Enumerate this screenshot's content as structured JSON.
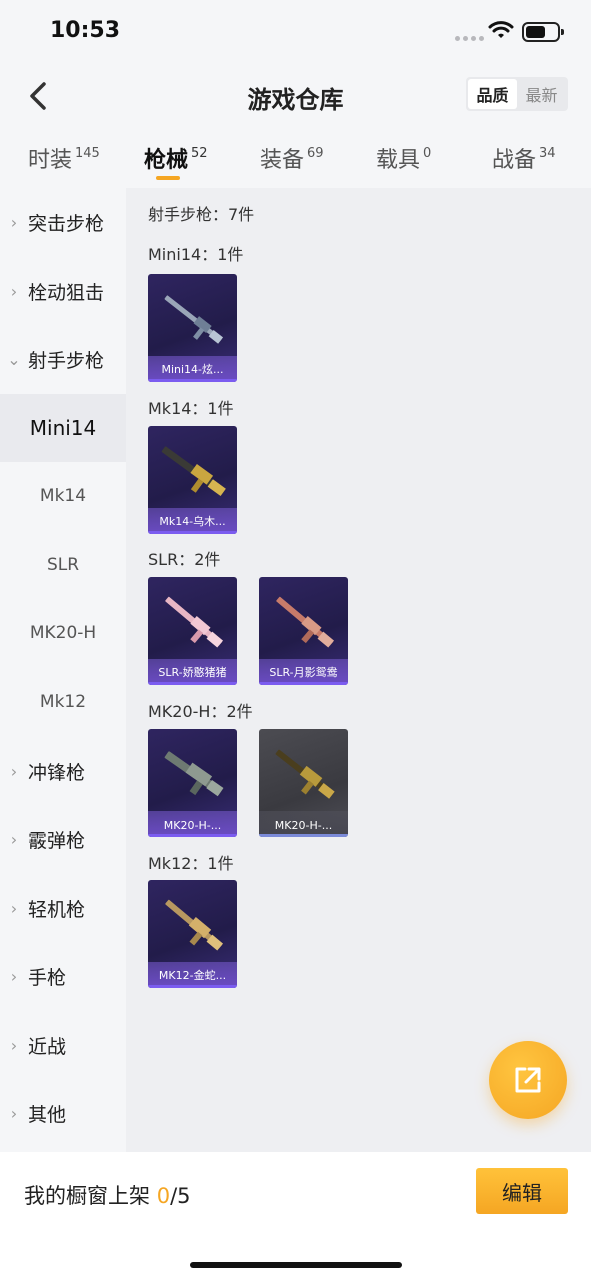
{
  "status": {
    "time": "10:53"
  },
  "nav": {
    "title": "游戏仓库",
    "sort": [
      "品质",
      "最新"
    ]
  },
  "tabs": [
    {
      "label": "时装",
      "count": "145"
    },
    {
      "label": "枪械",
      "count": "52"
    },
    {
      "label": "装备",
      "count": "69"
    },
    {
      "label": "载具",
      "count": "0"
    },
    {
      "label": "战备",
      "count": "34"
    }
  ],
  "sidebar": {
    "cats": [
      "突击步枪",
      "栓动狙击",
      "射手步枪",
      "冲锋枪",
      "霰弹枪",
      "轻机枪",
      "手枪",
      "近战",
      "其他"
    ],
    "subs": [
      "Mini14",
      "Mk14",
      "SLR",
      "MK20-H",
      "Mk12"
    ]
  },
  "content": {
    "category_title": "射手步枪：7件",
    "groups": [
      {
        "title": "Mini14：1件",
        "items": [
          "Mini14-炫..."
        ]
      },
      {
        "title": "Mk14：1件",
        "items": [
          "Mk14-乌木..."
        ]
      },
      {
        "title": "SLR：2件",
        "items": [
          "SLR-娇憨猪猪",
          "SLR-月影鸳鸯"
        ]
      },
      {
        "title": "MK20-H：2件",
        "items": [
          "MK20-H-...",
          "MK20-H-..."
        ]
      },
      {
        "title": "Mk12：1件",
        "items": [
          "MK12-金蛇..."
        ]
      }
    ]
  },
  "bottom": {
    "shelf_label": "我的橱窗上架",
    "shelf_current": "0",
    "shelf_total": "/5",
    "edit_label": "编辑"
  },
  "colors": {
    "accent": "#f5a623",
    "card_purple": "#2f2560",
    "card_grey": "#4c4c52"
  },
  "icons": [
    "back-arrow-icon",
    "wifi-icon",
    "battery-icon",
    "chevron-right-icon",
    "chevron-down-icon",
    "share-icon"
  ]
}
